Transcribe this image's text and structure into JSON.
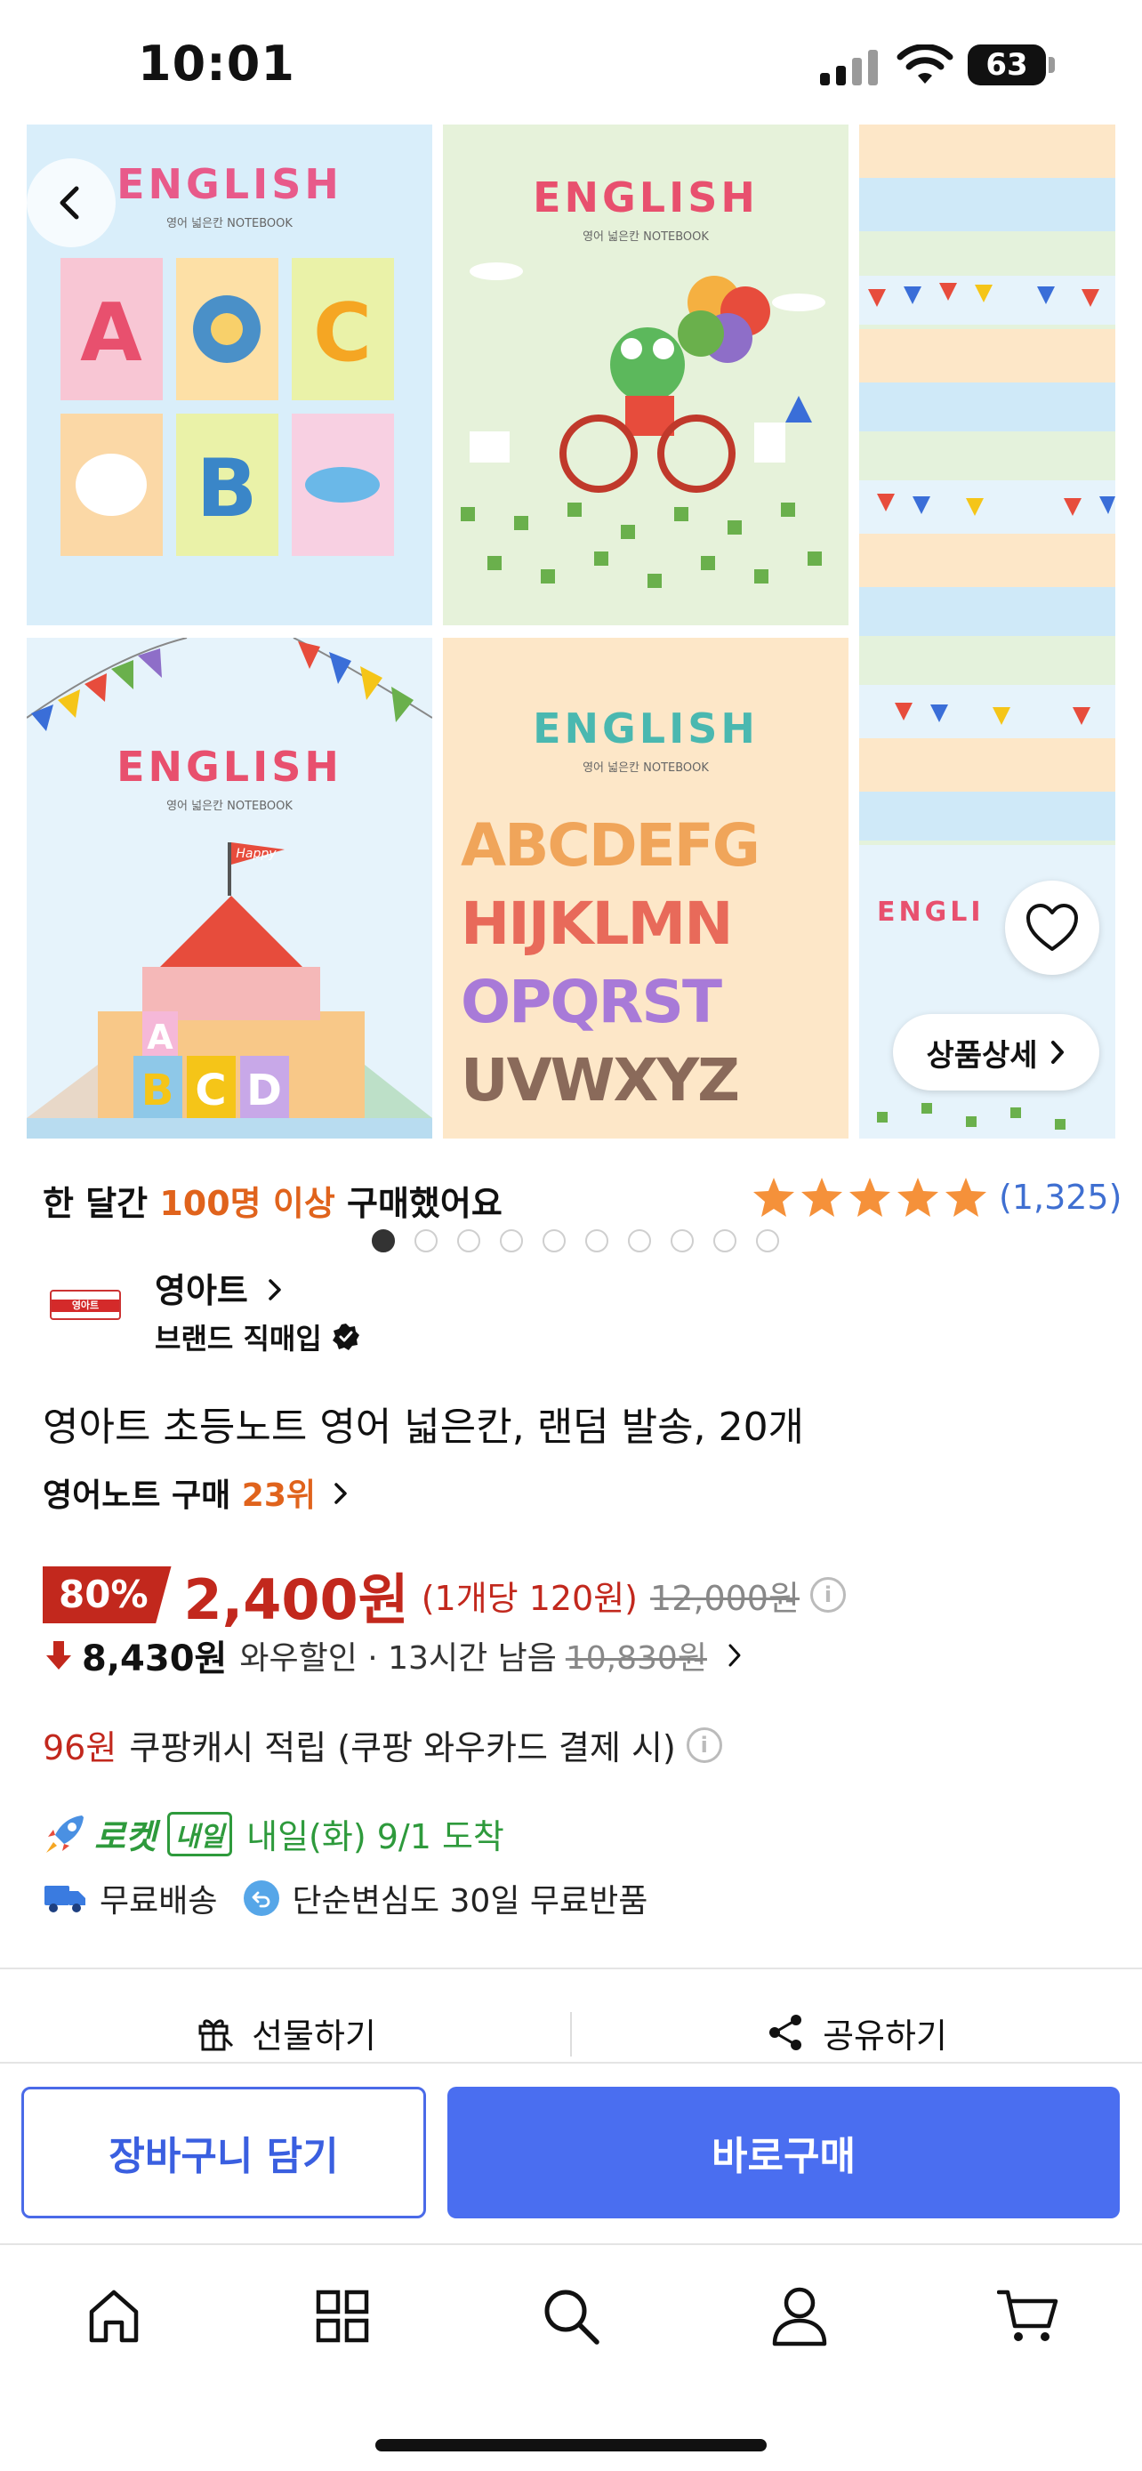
{
  "status_bar": {
    "time": "10:01",
    "battery": "63"
  },
  "gallery": {
    "image1": {
      "title": "ENGLISH",
      "subtitle": "영어 넓은칸 NOTEBOOK"
    },
    "image2": {
      "title": "ENGLISH",
      "subtitle": "영어 넓은칸 NOTEBOOK"
    },
    "image4": {
      "title": "ENGLISH",
      "subtitle": "영어 넓은칸 NOTEBOOK",
      "flag": "Happy"
    },
    "image5": {
      "title": "ENGLISH",
      "subtitle": "영어 넓은칸 NOTEBOOK",
      "letters": [
        "ABCDEFG",
        "HIJKLMN",
        "OPQRST",
        "UVWXYZ"
      ]
    },
    "image3": {
      "title": "ENGLI"
    },
    "detail_button": "상품상세",
    "dot_count": 10,
    "active_dot": 0
  },
  "purchase": {
    "prefix": "한 달간 ",
    "highlight": "100명 이상",
    "suffix": " 구매했어요"
  },
  "rating": {
    "stars": 5,
    "count": "(1,325)"
  },
  "brand": {
    "logo_text": "영아트",
    "name": "영아트",
    "badge": "브랜드 직매입"
  },
  "product": {
    "title": "영아트 초등노트 영어 넓은칸, 랜덤 발송, 20개"
  },
  "rank": {
    "category": "영어노트 구매 ",
    "rank": "23위"
  },
  "price": {
    "discount": "80%",
    "sale": "2,400원",
    "unit": "(1개당 120원)",
    "original": "12,000원"
  },
  "wow": {
    "price": "8,430원",
    "label": "와우할인 · 13시간 남음",
    "original": "10,830원"
  },
  "cash": {
    "amount": "96원",
    "text": "쿠팡캐시 적립 (쿠팡 와우카드 결제 시)"
  },
  "delivery": {
    "rocket": "로켓",
    "badge": "내일",
    "arrival": "내일(화) 9/1 도착"
  },
  "shipping": {
    "free": "무료배송",
    "returns": "단순변심도 30일 무료반품"
  },
  "actions": {
    "gift": "선물하기",
    "share": "공유하기"
  },
  "buttons": {
    "cart": "장바구니 담기",
    "buy": "바로구매"
  },
  "colors": {
    "accent": "#4a6ef0",
    "price_red": "#c2281d",
    "highlight_orange": "#e0631c",
    "rocket_green": "#2e9a3c"
  }
}
